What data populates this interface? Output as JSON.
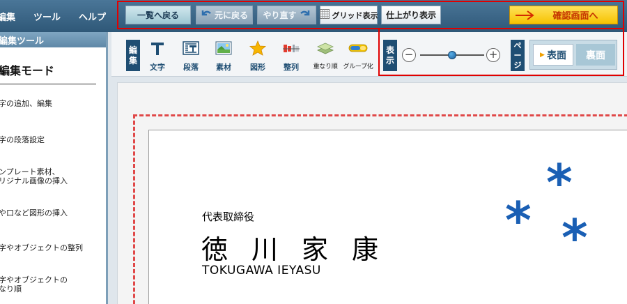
{
  "menu": {
    "items": [
      "編集",
      "ツール",
      "ヘルプ"
    ]
  },
  "toolbar": {
    "back_to_list": "一覧へ戻る",
    "undo": "元に戻る",
    "redo": "やり直す",
    "grid": "グリッド表示",
    "finish_view": "仕上がり表示",
    "confirm": "確認画面へ"
  },
  "left_panel": {
    "header": "編集ツール",
    "title": "編集モード",
    "items": [
      "字の追加、編集",
      "字の段落設定",
      "ンプレート素材、",
      "リジナル画像の挿入",
      "や口など図形の挿入",
      "字やオブジェクトの整列",
      "字やオブジェクトの",
      "なり順"
    ]
  },
  "tools": {
    "section_label": "編集",
    "items": [
      {
        "label": "文字",
        "icon": "text-t-icon"
      },
      {
        "label": "段落",
        "icon": "paragraph-icon"
      },
      {
        "label": "素材",
        "icon": "image-material-icon"
      },
      {
        "label": "図形",
        "icon": "star-shape-icon"
      },
      {
        "label": "整列",
        "icon": "align-icon"
      },
      {
        "label": "重なり順",
        "icon": "layer-order-icon"
      },
      {
        "label": "グループ化",
        "icon": "group-icon"
      }
    ]
  },
  "view": {
    "label": "表示",
    "zoom_level": 0.5,
    "zoom_out": "−",
    "zoom_in": "+"
  },
  "page": {
    "label": "ページ",
    "front": "表面",
    "back": "裏面",
    "selected": "表面"
  },
  "card": {
    "role": "代表取締役",
    "name_chars": [
      "徳",
      "川",
      "家",
      "康"
    ],
    "name_roman": "TOKUGAWA IEYASU",
    "logo_glyph": "*"
  },
  "colors": {
    "highlight": "#e00000",
    "accent_blue": "#1a5fb4",
    "confirm_bg": "#f6c200",
    "confirm_text": "#c43200",
    "cut_line": "#e04848"
  }
}
